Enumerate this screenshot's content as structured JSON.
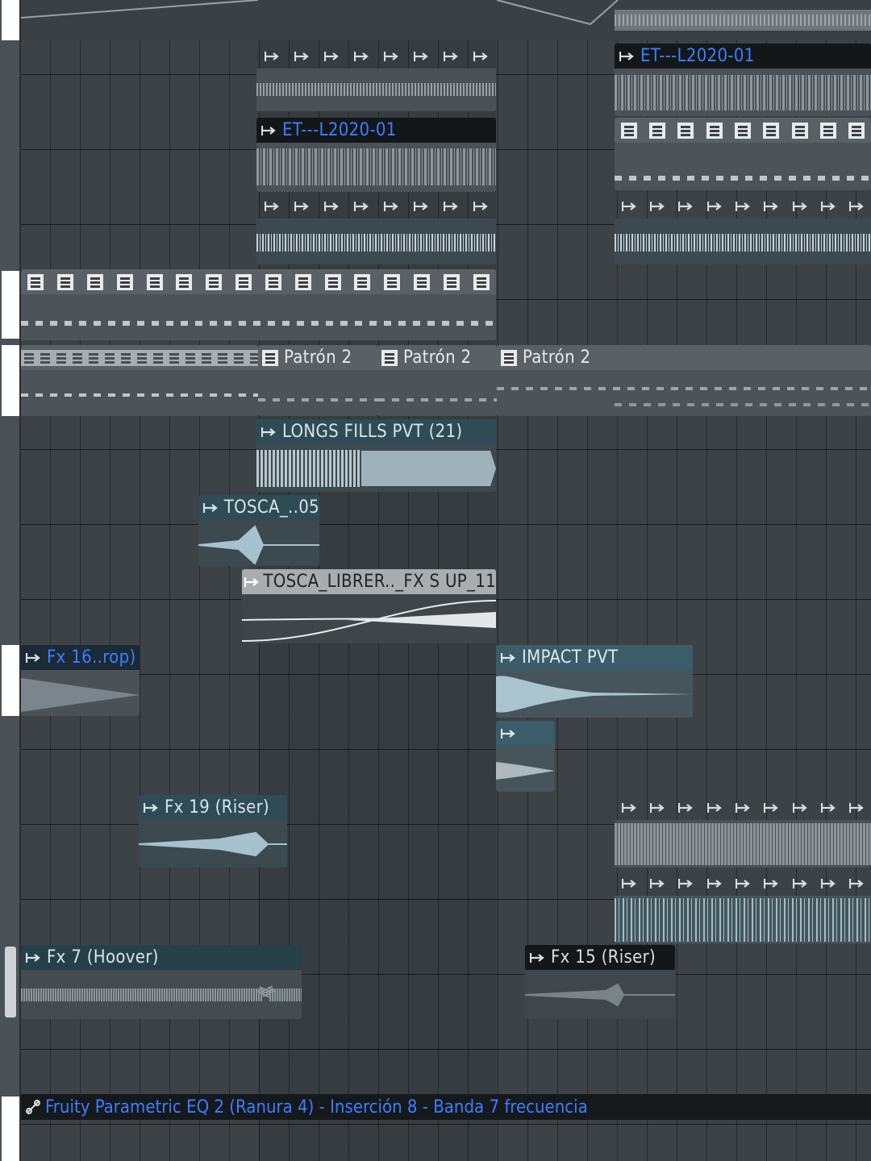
{
  "colors": {
    "accent_blue": "#3c7fff",
    "clip_teal": "#2f4c56",
    "grid": "#3c4246"
  },
  "clips": {
    "et_top_right": "ET---L2020-01",
    "et_mid": "ET---L2020-01",
    "patron_1": "Patrón 2",
    "patron_2": "Patrón 2",
    "patron_3": "Patrón 2",
    "longs_fills": "LONGS FILLS PVT (21)",
    "tosca_05": "TOSCA_..05",
    "tosca_librer": "TOSCA_LIBRER.._FX S UP_11",
    "fx16": "Fx 16..rop)",
    "impact": "IMPACT PVT",
    "fx19": "Fx 19 (Riser)",
    "fx7": "Fx 7 (Hoover)",
    "fx15": "Fx 15 (Riser)"
  },
  "automation": {
    "label": "Fruity Parametric EQ 2 (Ranura 4) - Inserción 8 - Banda 7 frecuencia",
    "icon": "automation-link-icon"
  },
  "icons": {
    "audio_clip": "audio-clip-icon",
    "pattern": "pattern-icon"
  }
}
